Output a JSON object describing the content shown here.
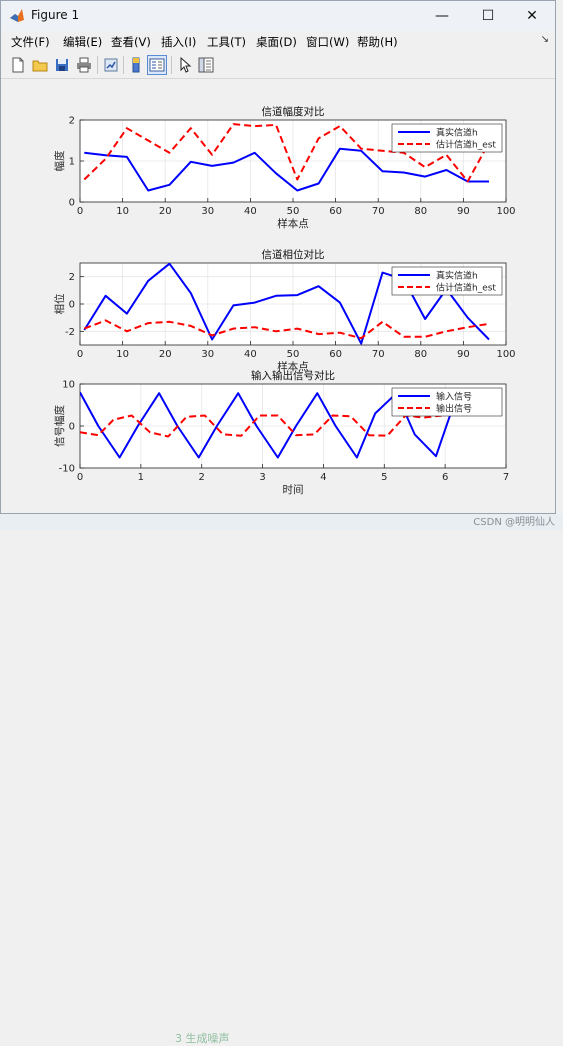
{
  "window": {
    "title": "Figure 1",
    "controls": {
      "minimize": "—",
      "maximize": "☐",
      "close": "✕"
    }
  },
  "menubar": {
    "items": [
      "文件(F)",
      "编辑(E)",
      "查看(V)",
      "插入(I)",
      "工具(T)",
      "桌面(D)",
      "窗口(W)",
      "帮助(H)"
    ],
    "right_glyph": "↘"
  },
  "toolbar": {
    "icons": [
      "new-figure-icon",
      "open-icon",
      "save-icon",
      "print-icon",
      "link-icon",
      "colorbar-icon",
      "legend-icon",
      "pointer-icon",
      "property-inspector-icon"
    ]
  },
  "colors": {
    "blue": "#0000ff",
    "red": "#ff0000",
    "grid": "#e6e6e6"
  },
  "chart_data": [
    {
      "type": "line",
      "title": "信道幅度对比",
      "xlabel": "样本点",
      "ylabel": "幅度",
      "xlim": [
        0,
        100
      ],
      "ylim": [
        0,
        2
      ],
      "xticks": [
        0,
        10,
        20,
        30,
        40,
        50,
        60,
        70,
        80,
        90,
        100
      ],
      "yticks": [
        0,
        1,
        2
      ],
      "grid": true,
      "legend_position": "top-right",
      "x": [
        1,
        6,
        11,
        16,
        21,
        26,
        31,
        36,
        41,
        46,
        51,
        56,
        61,
        66,
        71,
        76,
        81,
        86,
        91,
        96
      ],
      "series": [
        {
          "name": "真实信道h",
          "style": "solid",
          "color": "#0000ff",
          "values": [
            1.2,
            1.14,
            1.1,
            0.28,
            0.42,
            0.98,
            0.88,
            0.96,
            1.2,
            0.7,
            0.28,
            0.45,
            1.3,
            1.25,
            0.75,
            0.72,
            0.62,
            0.78,
            0.5,
            0.5
          ]
        },
        {
          "name": "估计信道h_est",
          "style": "dashed",
          "color": "#ff0000",
          "values": [
            0.55,
            1.05,
            1.8,
            1.5,
            1.2,
            1.8,
            1.15,
            1.9,
            1.85,
            1.88,
            0.55,
            1.55,
            1.85,
            1.3,
            1.25,
            1.2,
            0.85,
            1.15,
            0.5,
            1.45
          ]
        }
      ]
    },
    {
      "type": "line",
      "title": "信道相位对比",
      "xlabel": "样本点",
      "ylabel": "相位",
      "xlim": [
        0,
        100
      ],
      "ylim": [
        -3,
        3
      ],
      "xticks": [
        0,
        10,
        20,
        30,
        40,
        50,
        60,
        70,
        80,
        90,
        100
      ],
      "yticks": [
        -2,
        0,
        2
      ],
      "grid": true,
      "legend_position": "top-right",
      "x": [
        1,
        6,
        11,
        16,
        21,
        26,
        31,
        36,
        41,
        46,
        51,
        56,
        61,
        66,
        71,
        76,
        81,
        86,
        91,
        96
      ],
      "series": [
        {
          "name": "真实信道h",
          "style": "solid",
          "color": "#0000ff",
          "values": [
            -1.9,
            0.6,
            -0.7,
            1.7,
            2.95,
            0.8,
            -2.6,
            -0.1,
            0.1,
            0.6,
            0.65,
            1.3,
            0.1,
            -2.9,
            2.3,
            1.8,
            -1.1,
            1.1,
            -1.0,
            -2.6
          ]
        },
        {
          "name": "估计信道h_est",
          "style": "dashed",
          "color": "#ff0000",
          "values": [
            -1.8,
            -1.2,
            -2.0,
            -1.4,
            -1.3,
            -1.6,
            -2.3,
            -1.8,
            -1.7,
            -2.0,
            -1.8,
            -2.2,
            -2.1,
            -2.5,
            -1.3,
            -2.4,
            -2.4,
            -2.0,
            -1.7,
            -1.45
          ]
        }
      ]
    },
    {
      "type": "line",
      "title": "输入输出信号对比",
      "xlabel": "时间",
      "ylabel": "信号幅度",
      "xlim": [
        0,
        7
      ],
      "ylim": [
        -10,
        10
      ],
      "xticks": [
        0,
        1,
        2,
        3,
        4,
        5,
        6,
        7
      ],
      "yticks": [
        -10,
        0,
        10
      ],
      "grid": true,
      "legend_position": "top-right",
      "series": [
        {
          "name": "输入信号",
          "style": "solid",
          "color": "#0000ff",
          "x": [
            0,
            0.3,
            0.65,
            0.95,
            1.3,
            1.6,
            1.95,
            2.25,
            2.6,
            2.9,
            3.25,
            3.55,
            3.9,
            4.2,
            4.55,
            4.85,
            5.2,
            5.5,
            5.85,
            6.15
          ],
          "values": [
            8,
            0,
            -7.5,
            0,
            7.8,
            0,
            -7.5,
            0,
            7.8,
            0,
            -7.5,
            0,
            7.8,
            0,
            -7.5,
            3,
            7.8,
            -2,
            -7.2,
            5.5
          ]
        },
        {
          "name": "输出信号",
          "style": "dashed",
          "color": "#ff0000",
          "x": [
            0,
            0.3,
            0.55,
            0.85,
            1.15,
            1.45,
            1.75,
            2.05,
            2.35,
            2.65,
            2.95,
            3.25,
            3.55,
            3.85,
            4.15,
            4.45,
            4.75,
            5.05,
            5.35,
            5.65,
            5.95
          ],
          "values": [
            -1.5,
            -2.2,
            1.5,
            2.5,
            -1.5,
            -2.5,
            2.2,
            2.5,
            -2.0,
            -2.3,
            2.5,
            2.5,
            -2.2,
            -2.0,
            2.5,
            2.3,
            -2.2,
            -2.3,
            2.5,
            2.0,
            2.5
          ]
        }
      ]
    }
  ],
  "background": {
    "watermark": "CSDN @明明仙人",
    "peek_text": "3 生成噪声"
  }
}
